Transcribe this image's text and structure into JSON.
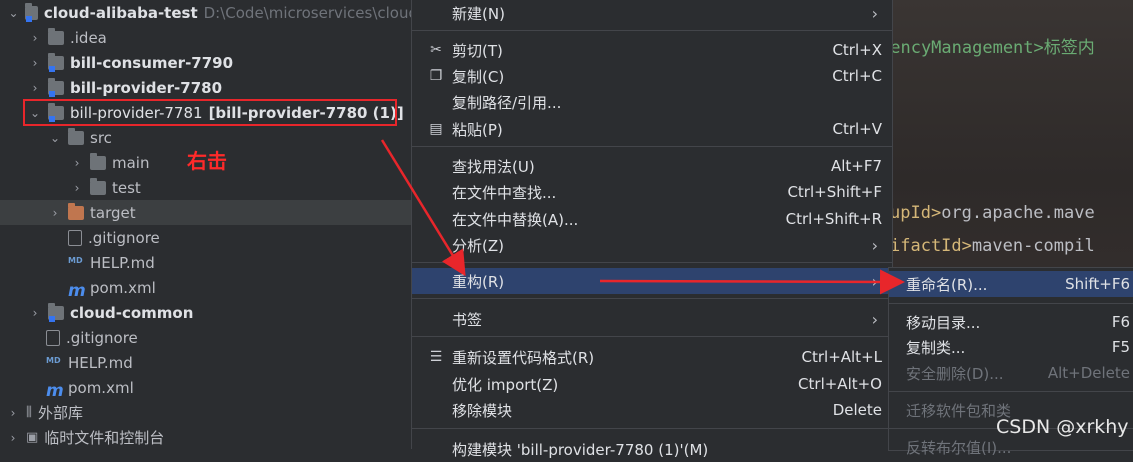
{
  "tree": {
    "root": {
      "name": "cloud-alibaba-test",
      "path": "D:\\Code\\microservices\\cloud"
    },
    "items": [
      {
        "label": ".idea"
      },
      {
        "label": "bill-consumer-7790"
      },
      {
        "label": "bill-provider-7780"
      },
      {
        "label": "bill-provider-7781",
        "extra": "[bill-provider-7780 (1)]"
      },
      {
        "label": "src"
      },
      {
        "label": "main"
      },
      {
        "label": "test"
      },
      {
        "label": "target"
      },
      {
        "label": ".gitignore"
      },
      {
        "label": "HELP.md"
      },
      {
        "label": "pom.xml"
      },
      {
        "label": "cloud-common"
      },
      {
        "label": ".gitignore"
      },
      {
        "label": "HELP.md"
      },
      {
        "label": "pom.xml"
      },
      {
        "label": "外部库"
      },
      {
        "label": "临时文件和控制台"
      }
    ]
  },
  "annotation": {
    "right_click": "右击"
  },
  "menu": {
    "items": [
      {
        "label": "新建(N)"
      },
      {
        "label": "剪切(T)",
        "shortcut": "Ctrl+X"
      },
      {
        "label": "复制(C)",
        "shortcut": "Ctrl+C"
      },
      {
        "label": "复制路径/引用..."
      },
      {
        "label": "粘贴(P)",
        "shortcut": "Ctrl+V"
      },
      {
        "label": "查找用法(U)",
        "shortcut": "Alt+F7"
      },
      {
        "label": "在文件中查找...",
        "shortcut": "Ctrl+Shift+F"
      },
      {
        "label": "在文件中替换(A)...",
        "shortcut": "Ctrl+Shift+R"
      },
      {
        "label": "分析(Z)"
      },
      {
        "label": "重构(R)"
      },
      {
        "label": "书签"
      },
      {
        "label": "重新设置代码格式(R)",
        "shortcut": "Ctrl+Alt+L"
      },
      {
        "label": "优化 import(Z)",
        "shortcut": "Ctrl+Alt+O"
      },
      {
        "label": "移除模块",
        "shortcut": "Delete"
      },
      {
        "label": "构建模块 'bill-provider-7780 (1)'(M)"
      }
    ]
  },
  "submenu": {
    "items": [
      {
        "label": "重命名(R)...",
        "shortcut": "Shift+F6"
      },
      {
        "label": "移动目录...",
        "shortcut": "F6"
      },
      {
        "label": "复制类...",
        "shortcut": "F5"
      },
      {
        "label": "安全删除(D)...",
        "shortcut": "Alt+Delete"
      },
      {
        "label": "迁移软件包和类"
      },
      {
        "label": "反转布尔值(I)..."
      }
    ]
  },
  "editor": {
    "line1_a": "dencyManagement>",
    "line1_b": "标签内",
    "line2_a": "upId>",
    "line2_b": "org.apache.mave",
    "line3_a": "ifactId>",
    "line3_b": "maven-compil"
  },
  "watermark": "CSDN @xrkhy",
  "colors": {
    "accent_selected": "#2e436e",
    "annotation_red": "#e8262b"
  }
}
